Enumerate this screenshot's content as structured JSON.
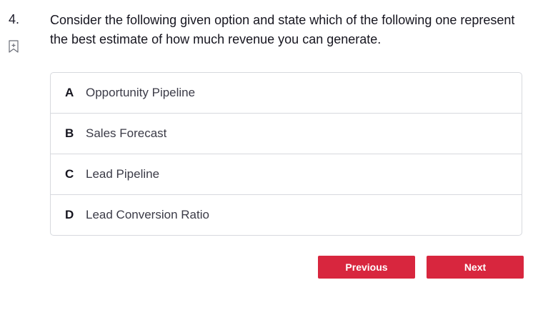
{
  "question": {
    "number": "4.",
    "text": "Consider the following given option and state which of the following one represent the best estimate of how much revenue you can generate."
  },
  "bookmark": {
    "icon": "bookmark-add-icon"
  },
  "options": [
    {
      "letter": "A",
      "text": "Opportunity Pipeline"
    },
    {
      "letter": "B",
      "text": "Sales Forecast"
    },
    {
      "letter": "C",
      "text": "Lead Pipeline"
    },
    {
      "letter": "D",
      "text": "Lead Conversion Ratio"
    }
  ],
  "navigation": {
    "previous_label": "Previous",
    "next_label": "Next"
  },
  "colors": {
    "accent": "#d8263e",
    "border": "#d7d9de"
  }
}
